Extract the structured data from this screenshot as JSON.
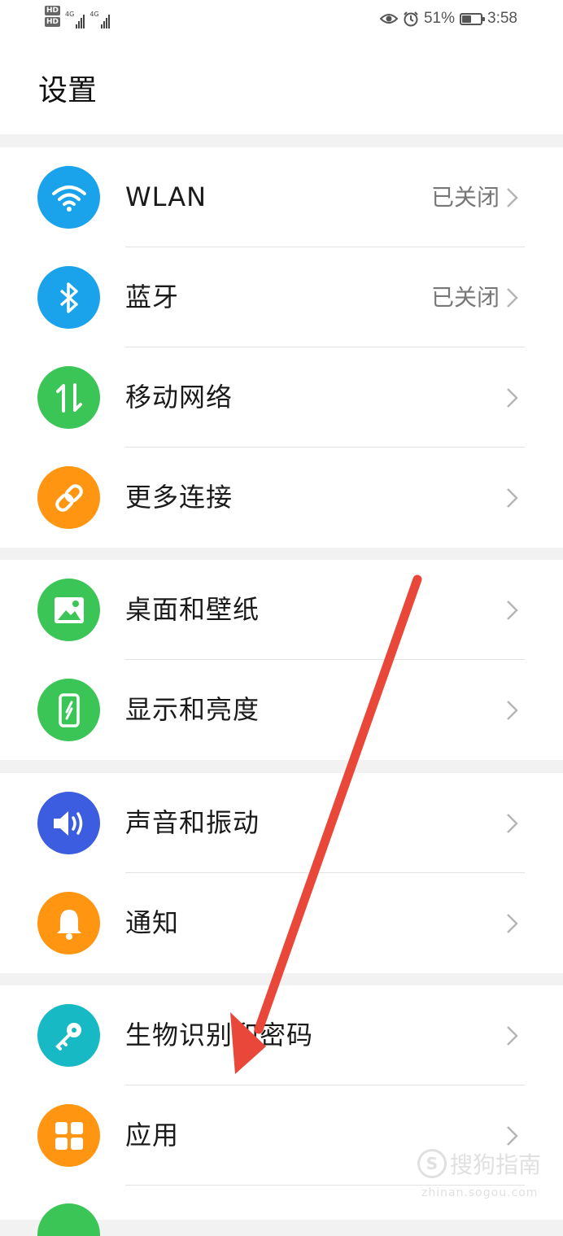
{
  "status_bar": {
    "hd1": "HD",
    "hd2": "HD",
    "net1": "4G",
    "net2": "4G",
    "battery_percent": "51%",
    "battery_level": 0.51,
    "time": "3:58",
    "icons": [
      "eye-icon",
      "alarm-icon",
      "battery-icon"
    ]
  },
  "header": {
    "title": "设置"
  },
  "groups": [
    {
      "items": [
        {
          "label": "WLAN",
          "value": "已关闭",
          "icon": "wifi-icon",
          "color": "#1aa3ea"
        },
        {
          "label": "蓝牙",
          "value": "已关闭",
          "icon": "bluetooth-icon",
          "color": "#1aa3ea"
        },
        {
          "label": "移动网络",
          "value": "",
          "icon": "mobile-data-icon",
          "color": "#3cc557"
        },
        {
          "label": "更多连接",
          "value": "",
          "icon": "link-icon",
          "color": "#ff9511"
        }
      ]
    },
    {
      "items": [
        {
          "label": "桌面和壁纸",
          "value": "",
          "icon": "wallpaper-icon",
          "color": "#3cc557"
        },
        {
          "label": "显示和亮度",
          "value": "",
          "icon": "display-icon",
          "color": "#3cc557"
        }
      ]
    },
    {
      "items": [
        {
          "label": "声音和振动",
          "value": "",
          "icon": "sound-icon",
          "color": "#3d5de0"
        },
        {
          "label": "通知",
          "value": "",
          "icon": "bell-icon",
          "color": "#ff9511"
        }
      ]
    },
    {
      "items": [
        {
          "label": "生物识别和密码",
          "value": "",
          "icon": "key-icon",
          "color": "#17b9c4"
        },
        {
          "label": "应用",
          "value": "",
          "icon": "apps-icon",
          "color": "#ff9511"
        }
      ]
    }
  ],
  "watermark": {
    "text": "搜狗指南",
    "sub": "zhinan.sogou.com"
  },
  "colors": {
    "annotation_arrow": "#e8473a",
    "chevron": "#b5b5b5"
  }
}
